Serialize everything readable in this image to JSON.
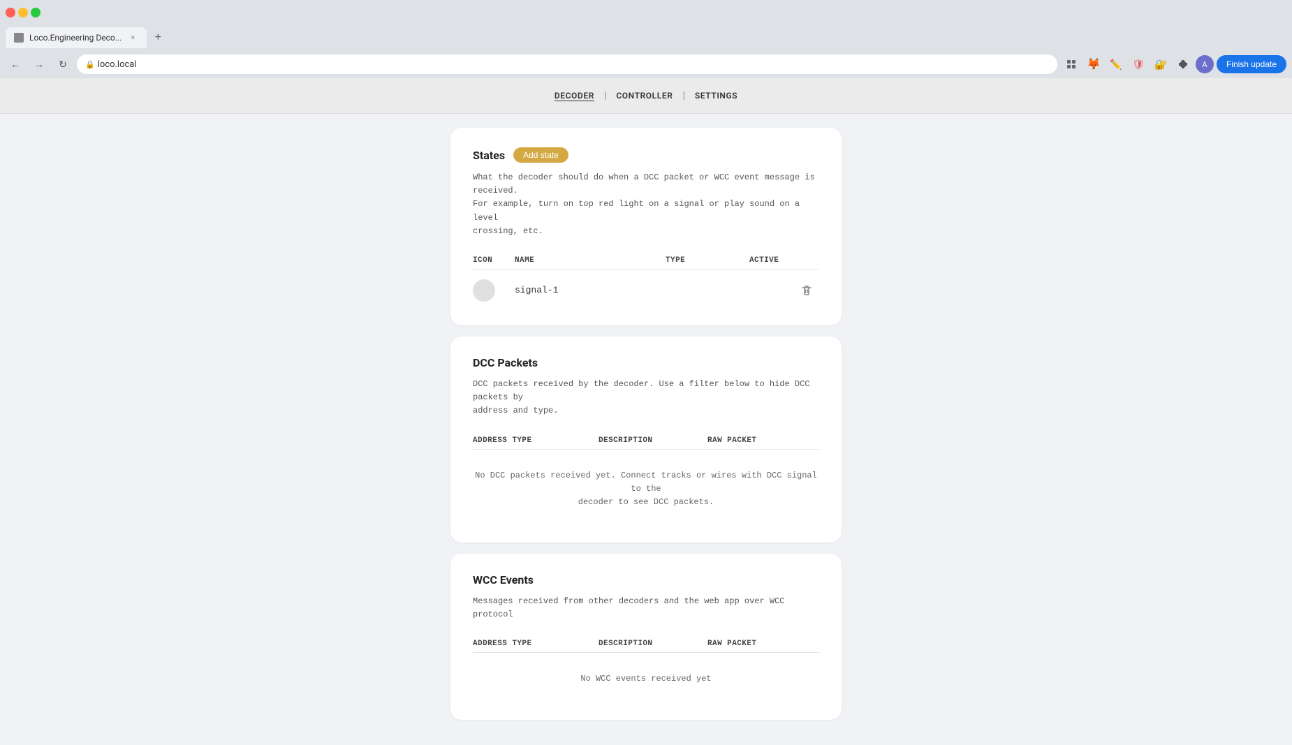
{
  "browser": {
    "tab_title": "Loco.Engineering Deco...",
    "url": "loco.local",
    "finish_update_label": "Finish update"
  },
  "nav": {
    "links": [
      {
        "id": "decoder",
        "label": "DECODER",
        "active": true
      },
      {
        "id": "controller",
        "label": "CONTROLLER",
        "active": false
      },
      {
        "id": "settings",
        "label": "SETTINGS",
        "active": false
      }
    ],
    "separator": "|"
  },
  "states_card": {
    "title": "States",
    "add_button_label": "Add state",
    "description": "What the decoder should do when a DCC packet or WCC event message is received.\nFor example, turn on top red light on a signal or play sound on a level\ncrossing, etc.",
    "columns": [
      "ICON",
      "NAME",
      "TYPE",
      "ACTIVE"
    ],
    "rows": [
      {
        "name": "signal-1",
        "type": "",
        "active": ""
      }
    ]
  },
  "dcc_card": {
    "title": "DCC Packets",
    "description": "DCC packets received by the decoder. Use a filter below to hide DCC packets by\naddress and type.",
    "columns": [
      "ADDRESS TYPE",
      "DESCRIPTION",
      "RAW PACKET"
    ],
    "empty_message": "No DCC packets received yet. Connect tracks or wires with DCC signal to the\ndecoder to see DCC packets."
  },
  "wcc_card": {
    "title": "WCC Events",
    "description": "Messages received from other decoders and the web app over WCC protocol",
    "columns": [
      "ADDRESS TYPE",
      "DESCRIPTION",
      "RAW PACKET"
    ],
    "empty_message": "No WCC events received yet"
  }
}
